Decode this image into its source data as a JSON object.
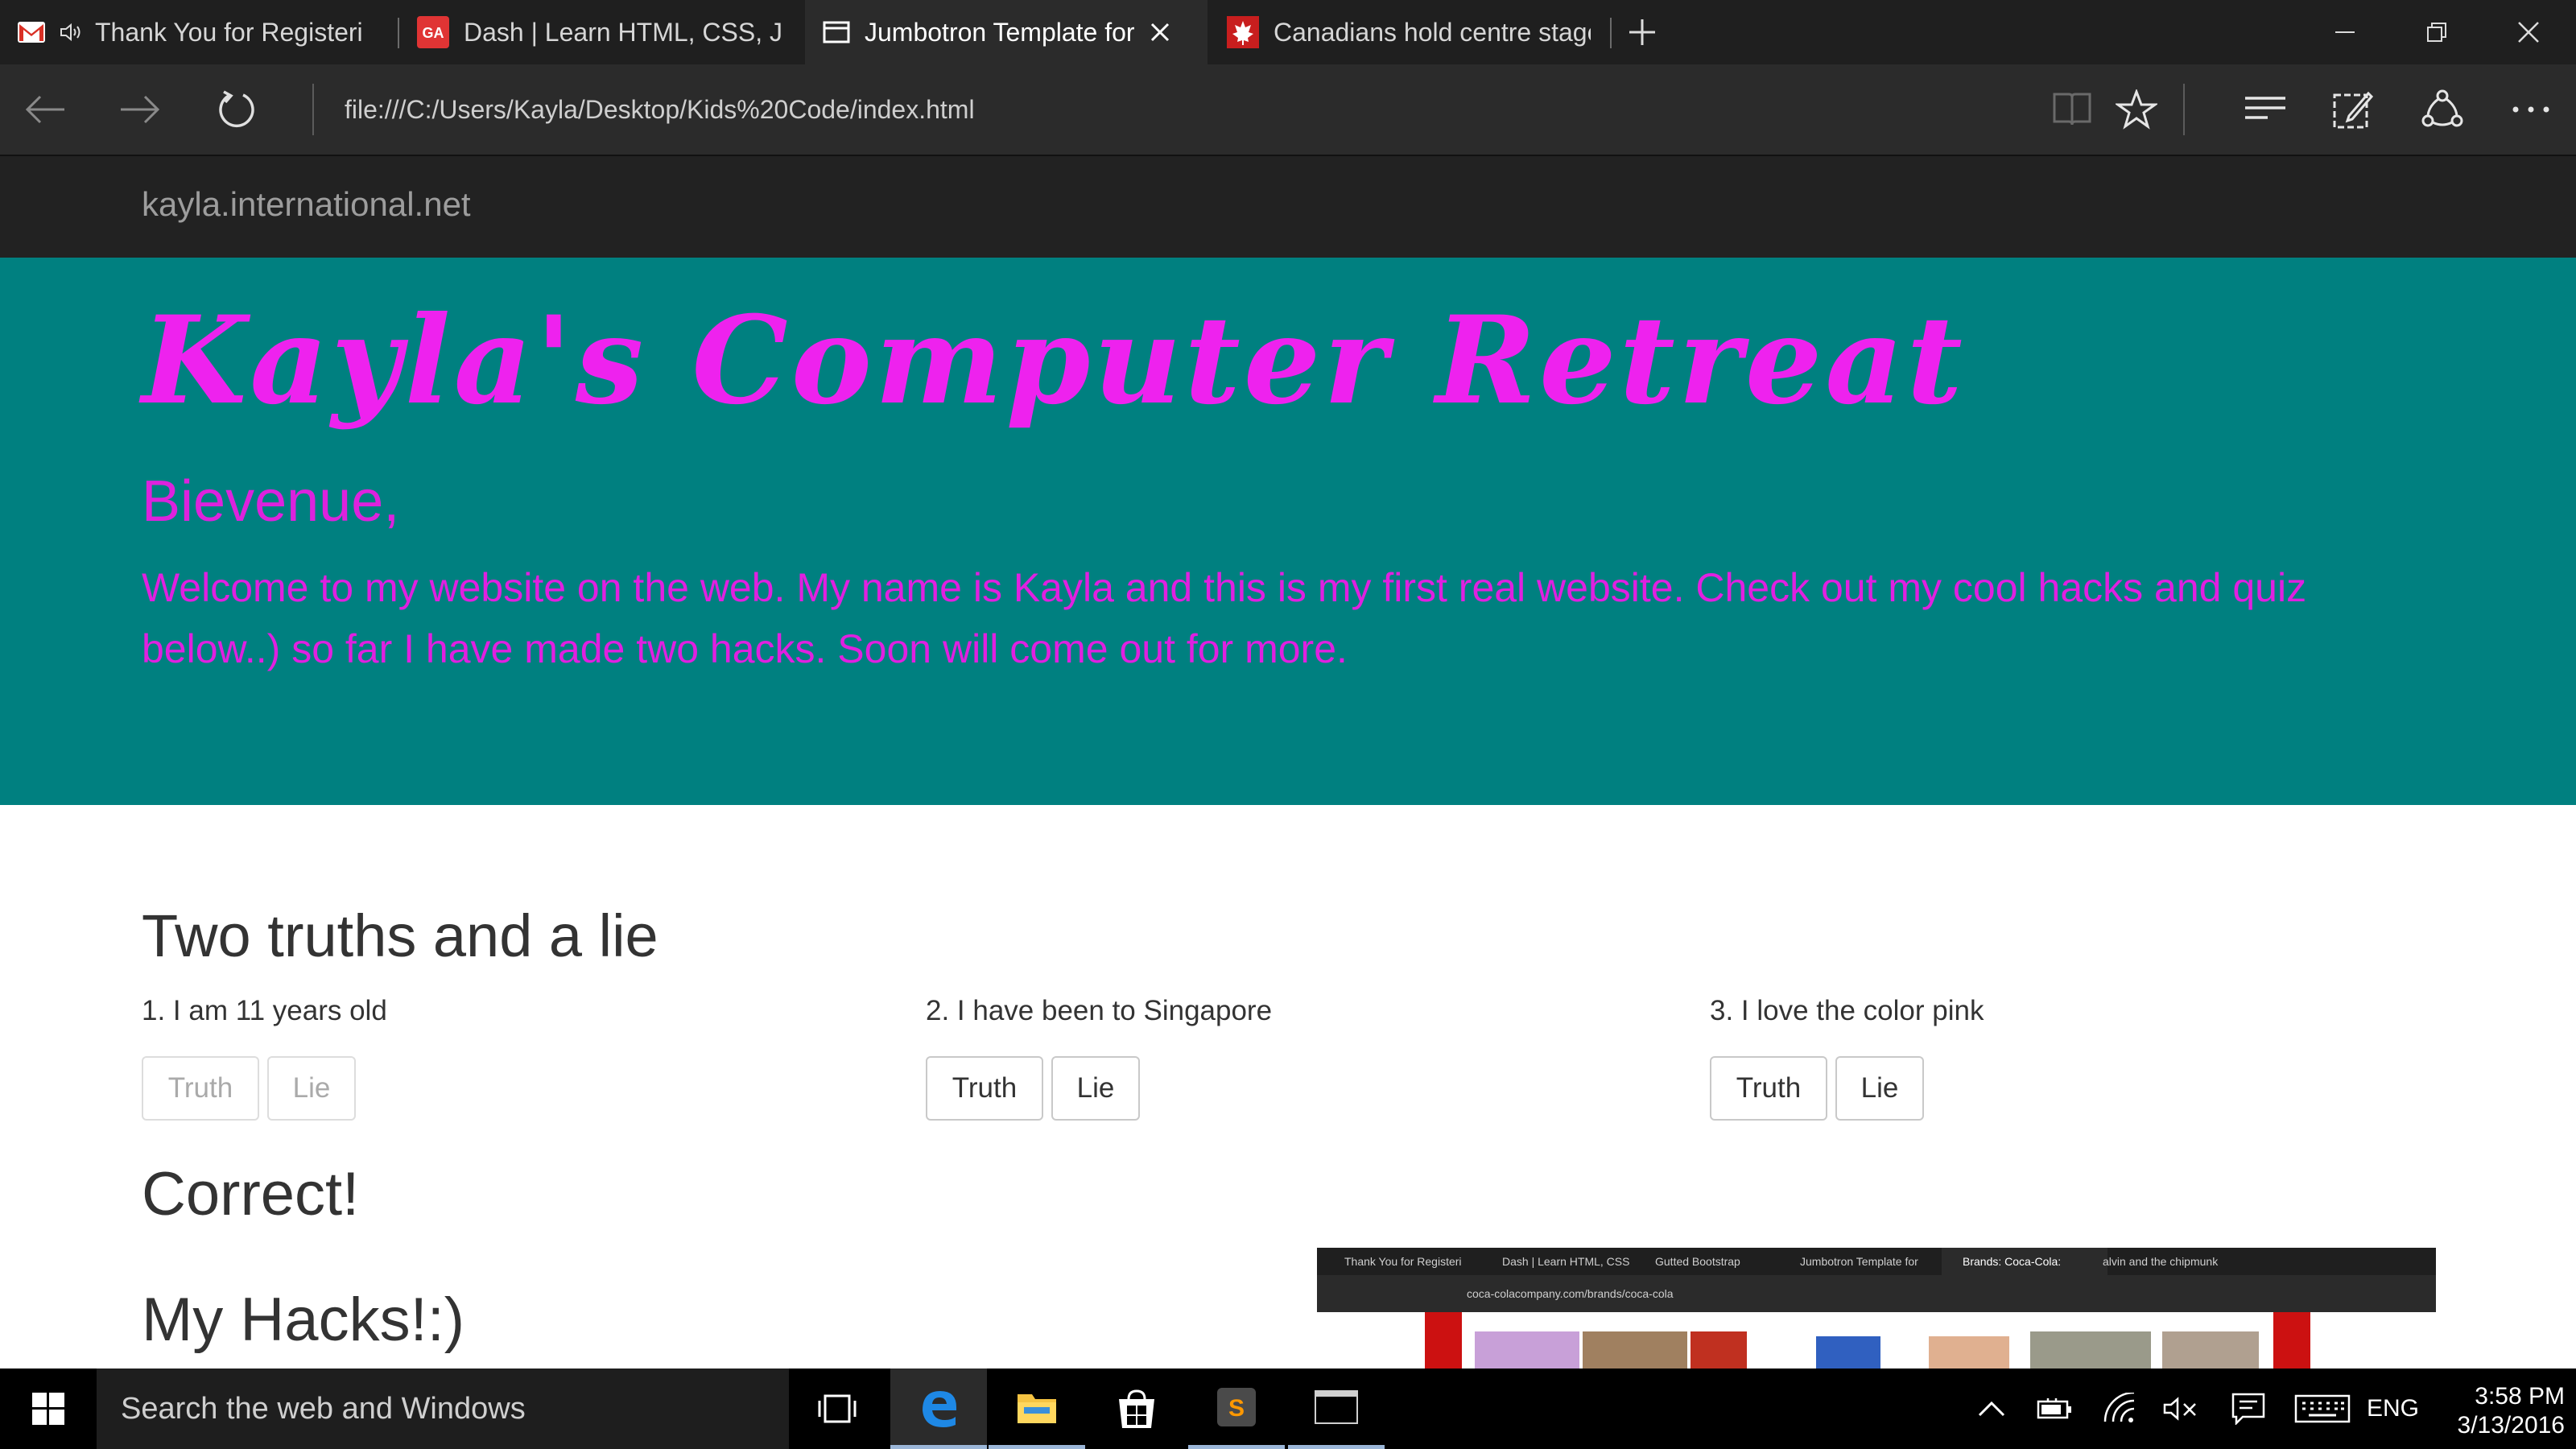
{
  "browser": {
    "tabs": [
      {
        "label": "Thank You for Registeri",
        "icon": "gmail-icon"
      },
      {
        "label": "Dash | Learn HTML, CSS, Jav",
        "icon": "ga-icon"
      },
      {
        "label": "Jumbotron Template for",
        "icon": "page-icon"
      },
      {
        "label": "Canadians hold centre stage",
        "icon": "maple-leaf-icon"
      }
    ],
    "url": "file:///C:/Users/Kayla/Desktop/Kids%20Code/index.html"
  },
  "site": {
    "brand": "kayla.international.net",
    "jumbotron": {
      "title": "Kayla's Computer Retreat",
      "greeting": "Bievenue,",
      "text": "Welcome to my website on the web. My name is Kayla and this is my first real website. Check out my cool hacks and quiz below..) so far I have made two hacks. Soon will come out for more."
    },
    "quiz": {
      "title": "Two truths and a lie",
      "statements": [
        {
          "text": "1. I am 11 years old",
          "truth_label": "Truth",
          "lie_label": "Lie"
        },
        {
          "text": "2. I have been to Singapore",
          "truth_label": "Truth",
          "lie_label": "Lie"
        },
        {
          "text": "3. I love the color pink",
          "truth_label": "Truth",
          "lie_label": "Lie"
        }
      ],
      "result": "Correct!"
    },
    "hacks_title": "My Hacks!:)",
    "embedded_screenshot": {
      "tabs": [
        "Thank You for Registeri",
        "Dash | Learn HTML, CSS",
        "Gutted Bootstrap",
        "Jumbotron Template for",
        "Brands: Coca-Cola:",
        "alvin and the chipmunk"
      ],
      "url": "coca-colacompany.com/brands/coca-cola"
    }
  },
  "taskbar": {
    "search_placeholder": "Search the web and Windows",
    "language": "ENG",
    "time": "3:58 PM",
    "date": "3/13/2016"
  },
  "colors": {
    "jumbotron_bg": "#008080",
    "jumbotron_text": "#ee22ee",
    "site_nav_bg": "#222222"
  }
}
